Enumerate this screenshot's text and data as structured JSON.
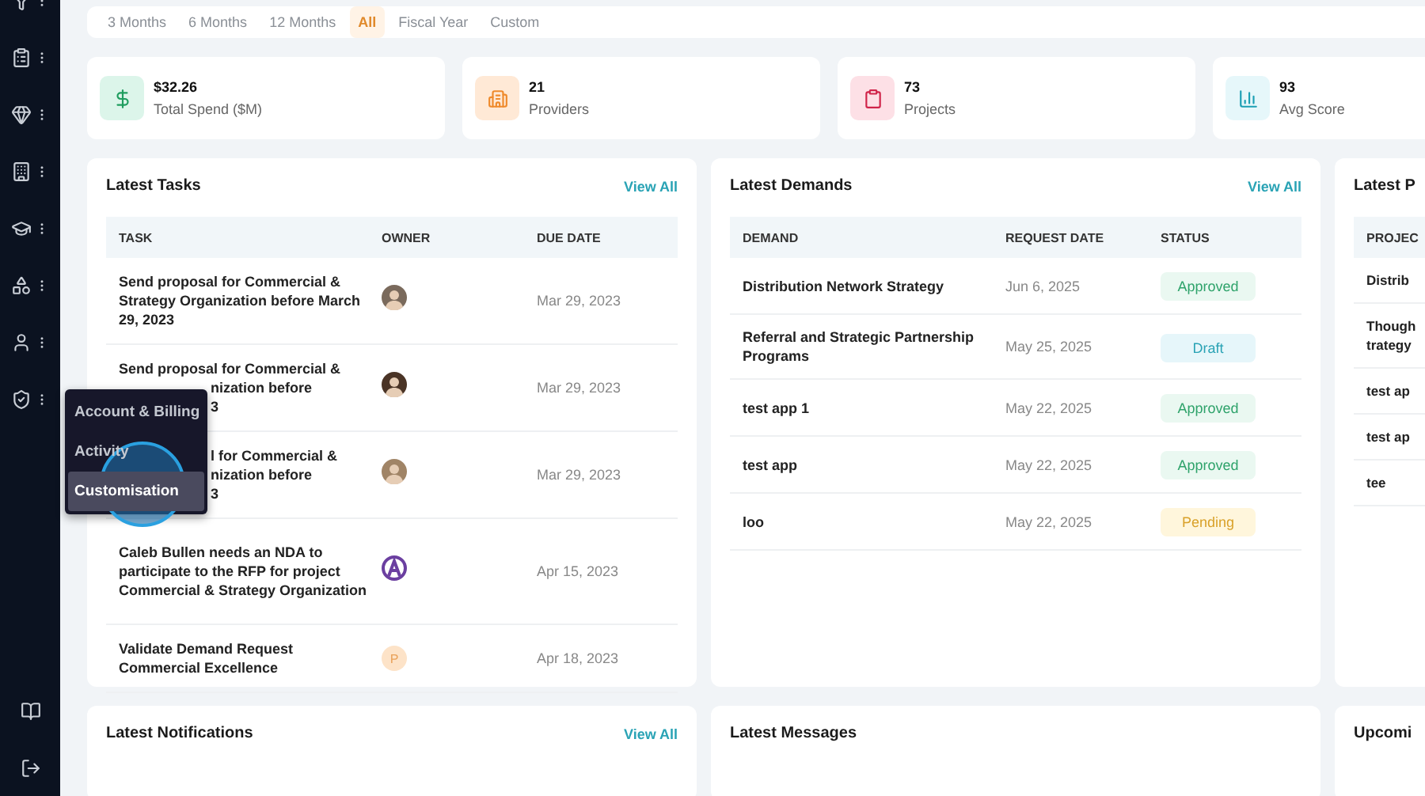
{
  "periods": [
    {
      "label": "3 Months",
      "selected": false
    },
    {
      "label": "6 Months",
      "selected": false
    },
    {
      "label": "12 Months",
      "selected": false
    },
    {
      "label": "All",
      "selected": true
    },
    {
      "label": "Fiscal Year",
      "selected": false
    },
    {
      "label": "Custom",
      "selected": false
    }
  ],
  "stats": [
    {
      "kind": "spend",
      "value": "$32.26",
      "label": "Total Spend ($M)"
    },
    {
      "kind": "providers",
      "value": "21",
      "label": "Providers"
    },
    {
      "kind": "projects",
      "value": "73",
      "label": "Projects"
    },
    {
      "kind": "score",
      "value": "93",
      "label": "Avg Score"
    }
  ],
  "tasks": {
    "title": "Latest Tasks",
    "link": "View All",
    "columns": [
      "TASK",
      "OWNER",
      "DUE DATE"
    ],
    "rows": [
      {
        "task": "Send proposal for Commercial & Strategy Organization before March 29, 2023",
        "owner": {
          "kind": "photo",
          "color": "#7a6a5c"
        },
        "due": "Mar 29, 2023"
      },
      {
        "task_shown": [
          "Send proposal for Commercial &"
        ],
        "task_fragments": [
          "nization before",
          "3"
        ],
        "owner": {
          "kind": "photo",
          "color": "#4a3426"
        },
        "due": "Mar 29, 2023"
      },
      {
        "task_fragments": [
          "l for Commercial &",
          "nization before",
          "3"
        ],
        "owner": {
          "kind": "photo",
          "color": "#a08466"
        },
        "due": "Mar 29, 2023"
      },
      {
        "task": "Caleb Bullen needs an NDA to participate to the RFP for project Commercial & Strategy Organization",
        "owner": {
          "kind": "logo",
          "color": "#6b3fa0"
        },
        "due": "Apr 15, 2023"
      },
      {
        "task": "Validate Demand Request Commercial Excellence",
        "owner": {
          "kind": "initial",
          "initial": "P",
          "color": "#fde3c8"
        },
        "due": "Apr 18, 2023"
      }
    ]
  },
  "demands": {
    "title": "Latest Demands",
    "link": "View All",
    "columns": [
      "DEMAND",
      "REQUEST DATE",
      "STATUS"
    ],
    "rows": [
      {
        "demand": "Distribution Network Strategy",
        "date": "Jun 6, 2025",
        "status": {
          "kind": "approved",
          "label": "Approved"
        }
      },
      {
        "demand": "Referral and Strategic Partnership Programs",
        "date": "May 25, 2025",
        "status": {
          "kind": "draft",
          "label": "Draft"
        }
      },
      {
        "demand": "test app 1",
        "date": "May 22, 2025",
        "status": {
          "kind": "approved",
          "label": "Approved"
        }
      },
      {
        "demand": "test app",
        "date": "May 22, 2025",
        "status": {
          "kind": "approved",
          "label": "Approved"
        }
      },
      {
        "demand": "loo",
        "date": "May 22, 2025",
        "status": {
          "kind": "pending",
          "label": "Pending"
        }
      }
    ]
  },
  "projects": {
    "title": "Latest P",
    "columns": [
      "PROJEC"
    ],
    "rows": [
      "Distrib",
      "Though trategy",
      "test ap",
      "test ap",
      "tee"
    ]
  },
  "bottom_panels": [
    {
      "title": "Latest Notifications",
      "link": "View All"
    },
    {
      "title": "Latest Messages"
    },
    {
      "title": "Upcomi"
    }
  ],
  "sidebar_menu": {
    "items": [
      {
        "label": "Account & Billing",
        "selected": false
      },
      {
        "label": "Activity",
        "selected": false
      },
      {
        "label": "Customisation",
        "selected": true
      }
    ]
  }
}
